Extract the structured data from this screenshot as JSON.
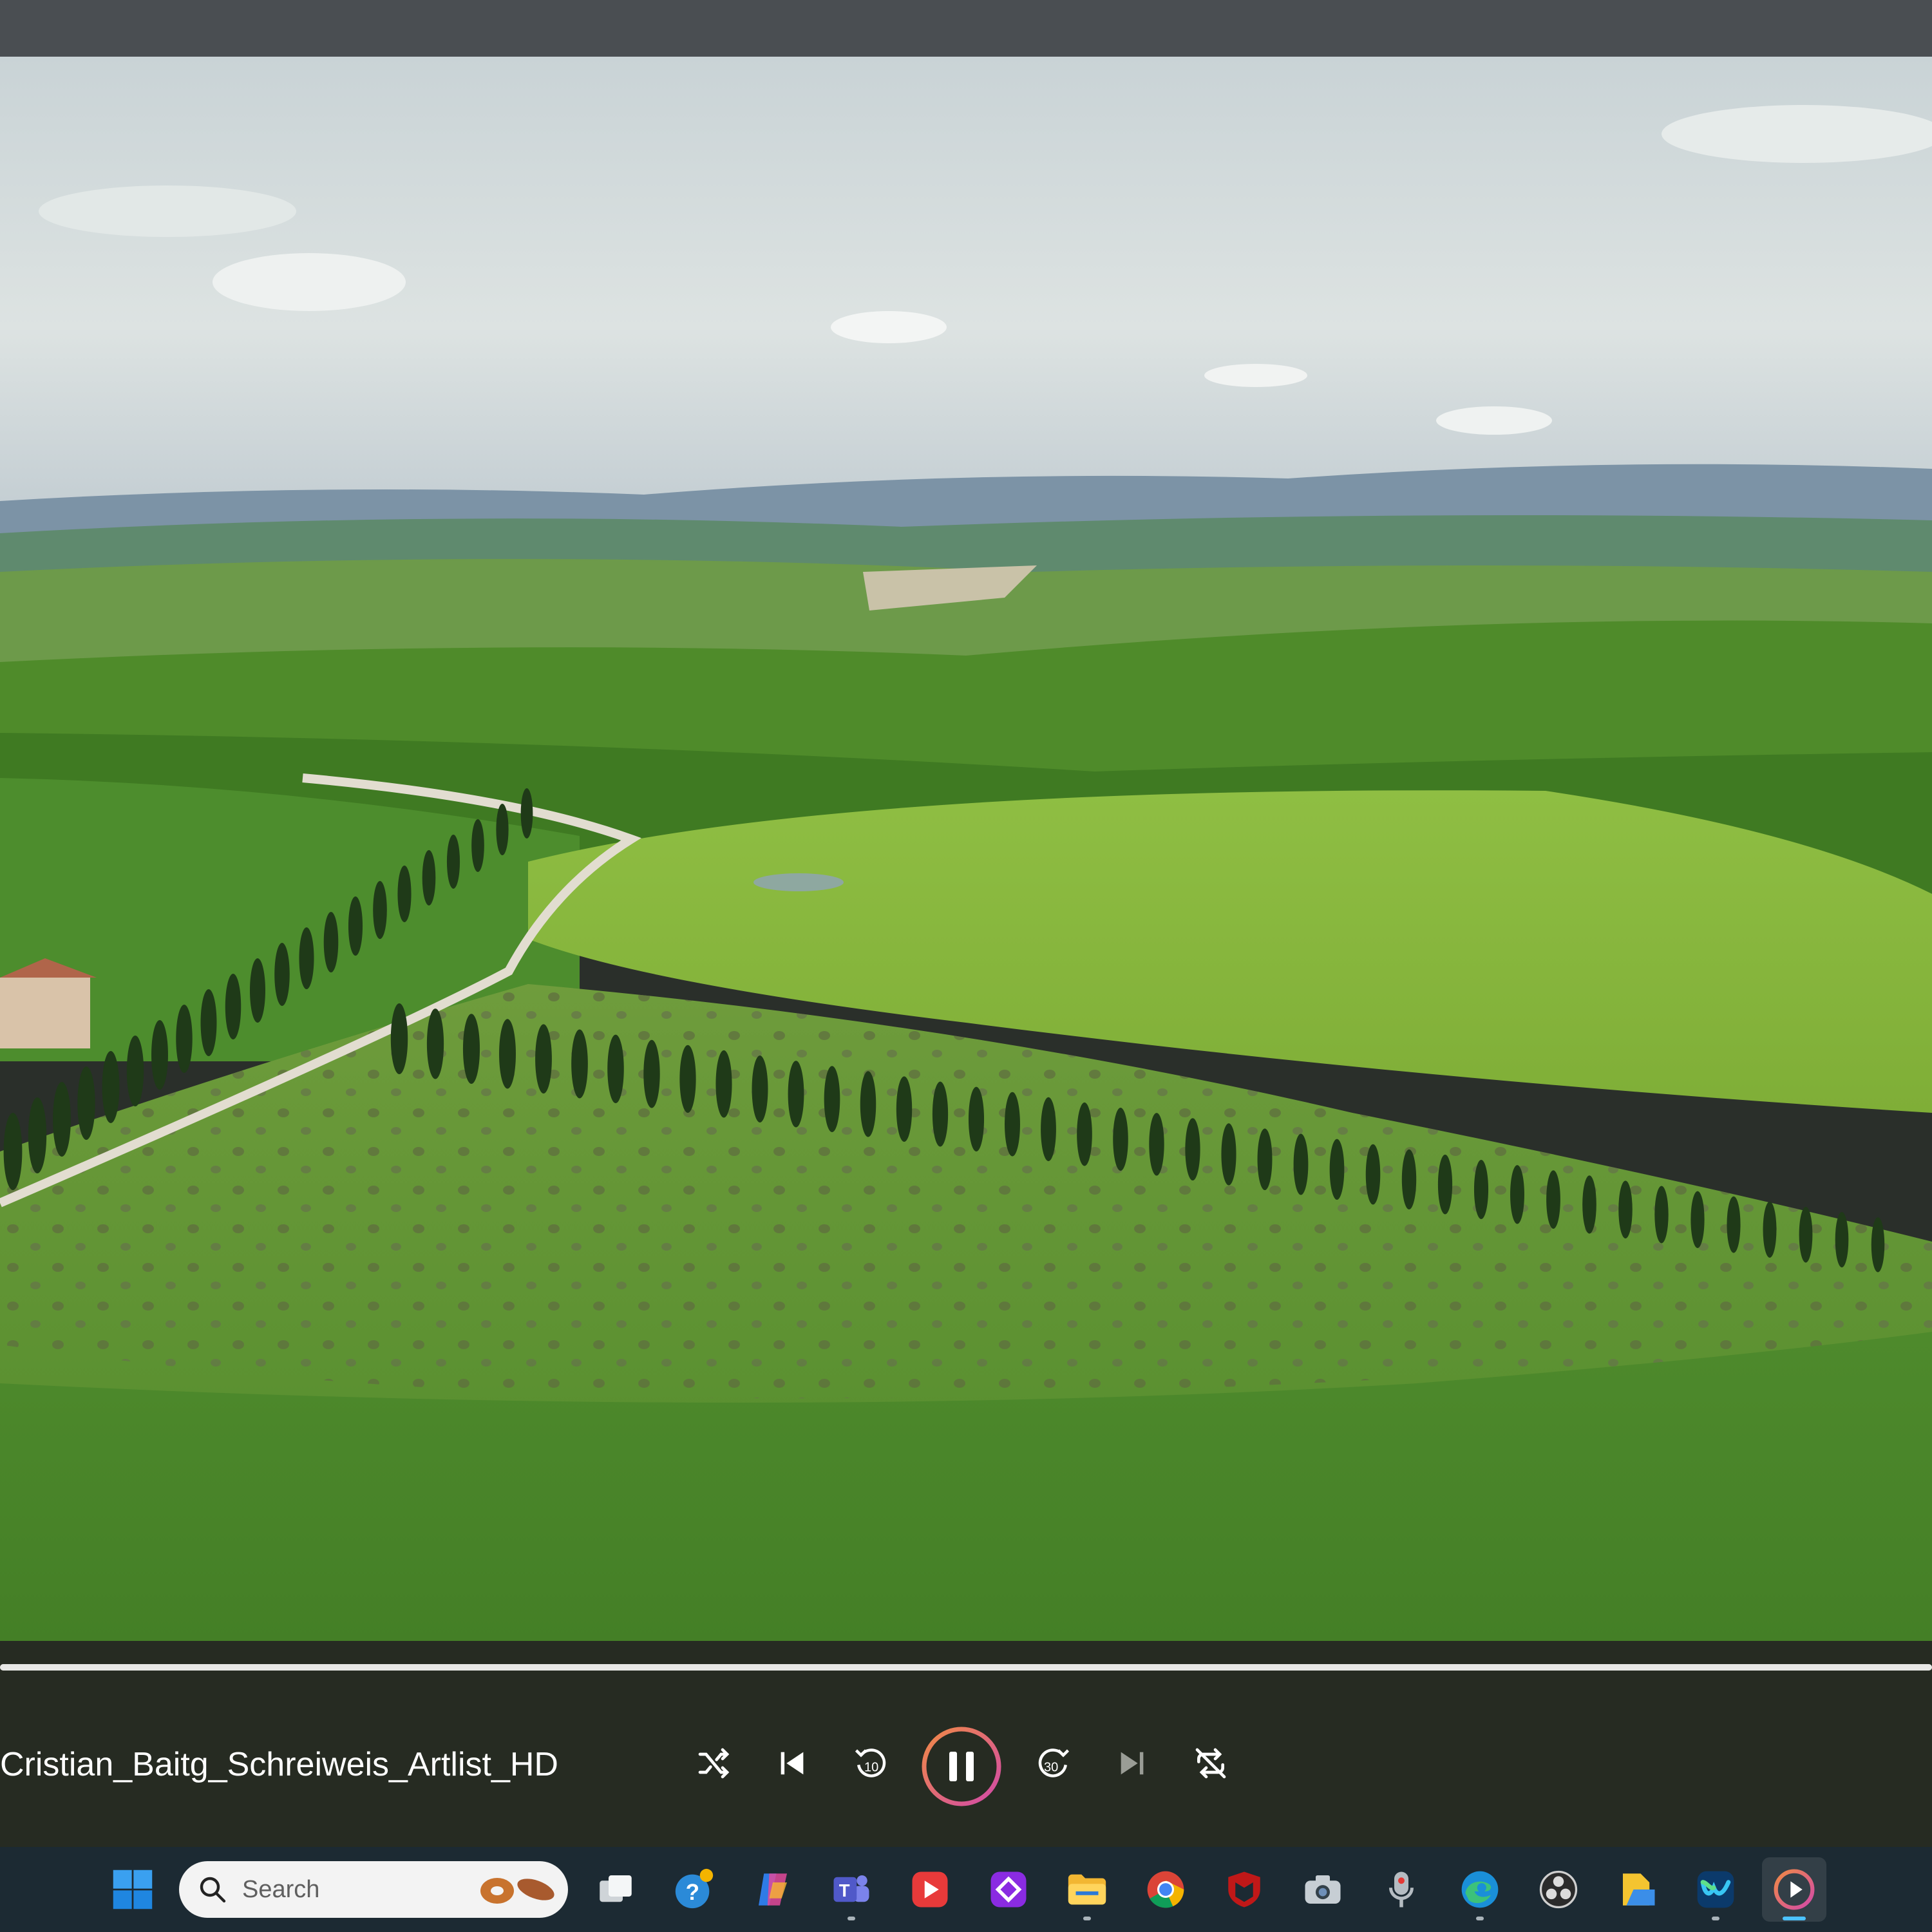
{
  "player": {
    "media_title": "Cristian_Baitg_Schreiweis_Artlist_HD",
    "progress_fraction": 1.0,
    "state": "playing",
    "accent_color": "#e8734a",
    "controls": [
      "shuffle-icon",
      "previous-icon",
      "skip-back-10-icon",
      "pause-icon",
      "skip-forward-30-icon",
      "next-icon",
      "repeat-off-icon"
    ],
    "skip_back_label": "10",
    "skip_forward_label": "30"
  },
  "taskbar": {
    "search_placeholder": "Search",
    "apps": [
      "windows-start",
      "search",
      "task-view",
      "get-help",
      "copilot",
      "teams",
      "video-app",
      "purple-app",
      "file-explorer",
      "chrome",
      "mcafee",
      "camera",
      "voice-recorder",
      "edge",
      "obs",
      "files",
      "webex",
      "media-player"
    ]
  }
}
